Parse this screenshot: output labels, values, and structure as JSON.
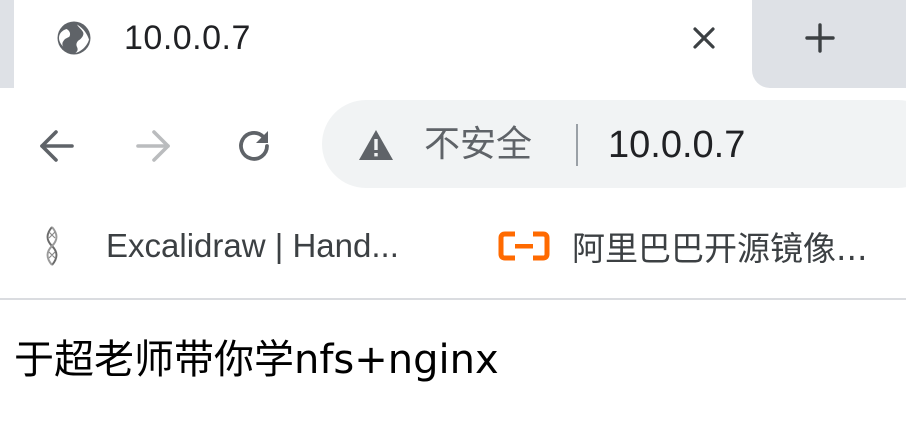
{
  "tab": {
    "title": "10.0.0.7",
    "favicon": "globe-icon",
    "close_icon": "close-icon"
  },
  "new_tab_icon": "plus-icon",
  "toolbar": {
    "back_icon": "back-arrow-icon",
    "forward_icon": "forward-arrow-icon",
    "reload_icon": "reload-icon"
  },
  "omnibox": {
    "security_icon": "warning-icon",
    "security_label": "不安全",
    "url": "10.0.0.7"
  },
  "bookmarks": [
    {
      "icon": "excalidraw-icon",
      "label": "Excalidraw | Hand..."
    },
    {
      "icon": "aliyun-icon",
      "label": "阿里巴巴开源镜像..."
    }
  ],
  "page": {
    "body_text": "于超老师带你学nfs+nginx"
  },
  "colors": {
    "tabstrip_bg": "#dee1e6",
    "omnibox_bg": "#f1f3f4",
    "aliyun_orange": "#ff6a00"
  }
}
